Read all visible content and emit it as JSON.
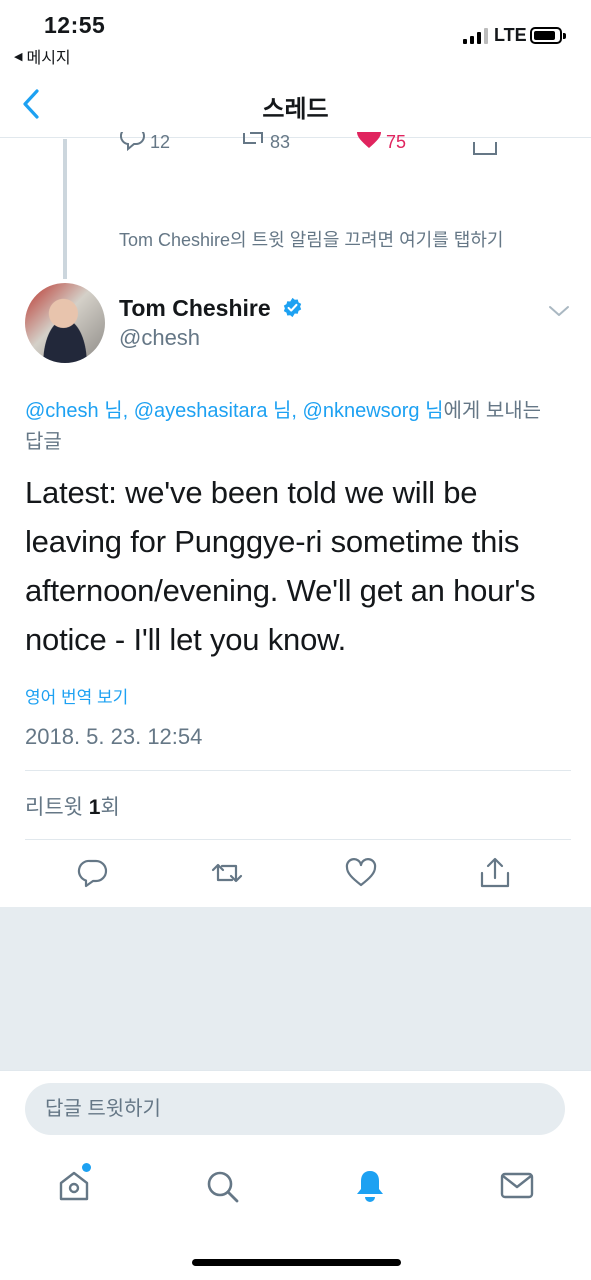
{
  "status_bar": {
    "time": "12:55",
    "back_app": "메시지",
    "carrier": "LTE"
  },
  "nav": {
    "title": "스레드",
    "back_icon": "chevron-left-icon"
  },
  "previous_tweet": {
    "reply_count": "12",
    "retweet_count": "83",
    "like_count": "75",
    "mute_notice": "Tom Cheshire의 트윗 알림을 끄려면 여기를 탭하기"
  },
  "tweet": {
    "author_name": "Tom Cheshire",
    "author_handle": "@chesh",
    "reply_mentions": [
      "@chesh 님,",
      "@ayeshasitara 님,",
      "@nknewsorg 님"
    ],
    "reply_suffix": "에게 보내는 답글",
    "text": "Latest: we've been told we will be leaving for Punggye-ri sometime this afternoon/evening. We'll get an hour's notice - I'll let you know.",
    "translate_label": "영어 번역 보기",
    "timestamp": "2018. 5. 23. 12:54",
    "retweet_prefix": "리트윗 ",
    "retweet_number": "1",
    "retweet_suffix": "회"
  },
  "composer": {
    "placeholder": "답글 트윗하기"
  },
  "tab_bar": {
    "items": [
      "home-icon",
      "search-icon",
      "notifications-icon",
      "messages-icon"
    ],
    "active": "notifications-icon"
  },
  "colors": {
    "accent": "#1da1f2",
    "secondary_text": "#657786",
    "like": "#e0245e",
    "background_gray": "#e6ecf0"
  }
}
